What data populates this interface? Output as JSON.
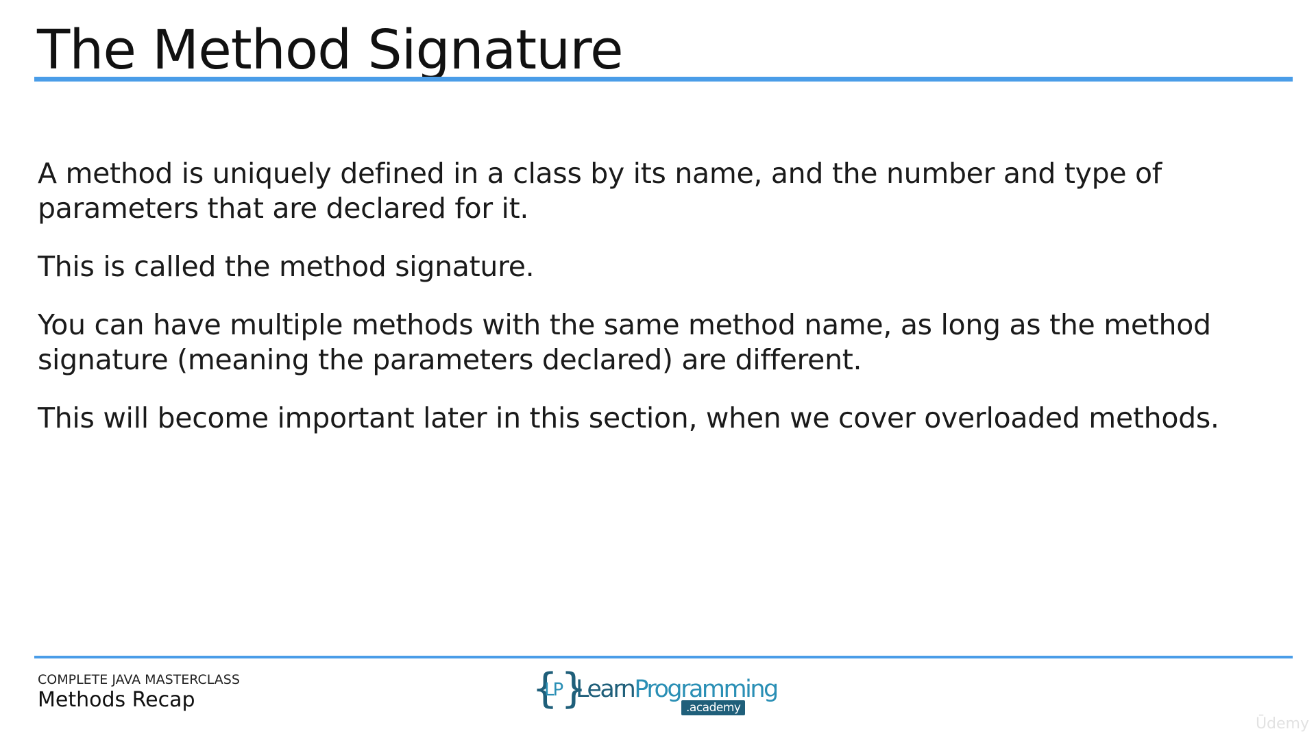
{
  "slide": {
    "title": "The Method Signature",
    "paragraphs": [
      "A method is uniquely defined in a class by its name, and the number and type of parameters that are declared for it.",
      "This is called the method signature.",
      "You can have multiple methods with the same method name, as long as the method signature (meaning the parameters declared) are different.",
      "This will become important later in this section, when we cover overloaded methods."
    ]
  },
  "footer": {
    "course": "COMPLETE JAVA MASTERCLASS",
    "lesson": "Methods Recap",
    "logo": {
      "brace_left": "{",
      "initials": "LP",
      "brace_right": "}",
      "word_learn": "Learn",
      "word_programming": "Programming",
      "sub": ".academy"
    }
  },
  "watermark": "Ūdemy",
  "colors": {
    "accent": "#4a9de8",
    "logo_dark": "#1f5f7a",
    "logo_light": "#2a8fb5"
  }
}
